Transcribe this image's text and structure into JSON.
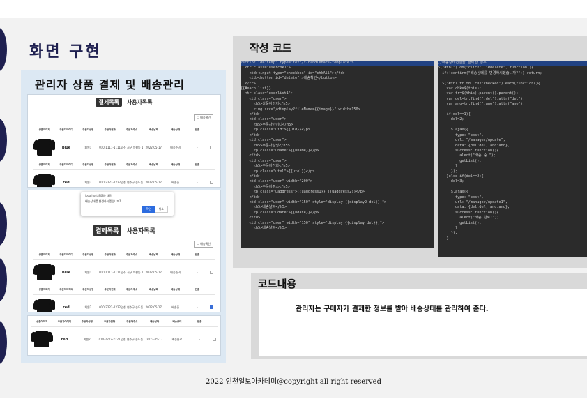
{
  "page_title": "화면 구현",
  "left": {
    "title": "관리자 상품 결제 및 배송관리",
    "tab_active": "결제목록",
    "tab_inactive": "사용자목록",
    "delete_button": "배송확인",
    "headers": [
      "상품이미지",
      "주문자아이디",
      "주문자성명",
      "주문자전화",
      "주문자주소",
      "배송날짜",
      "배송상태",
      "반품"
    ],
    "rows_a": [
      {
        "name": "blue",
        "info": [
          "회원1",
          "010-1111-1111",
          "광주 서구 치평동 1 세부주소",
          "2022-05-17",
          "배송준비"
        ]
      },
      {
        "name": "red",
        "info": [
          "회원2",
          "010-2222-2222",
          "인천 연수구 송도동 2 세부주소",
          "2022-05-17",
          "배송중"
        ]
      }
    ],
    "dialog_host": "localhost:8080 내용:",
    "dialog_msg": "배송상태를 변경하시겠습니까?",
    "dialog_ok": "확인",
    "dialog_cancel": "취소",
    "rows_b": [
      {
        "name": "blue",
        "info": [
          "회원1",
          "010-1111-1111",
          "광주 서구 치평동 1 세부주소",
          "2022-05-17",
          "배송준비"
        ]
      },
      {
        "name": "red",
        "info": [
          "회원2",
          "010-2222-2222",
          "인천 연수구 송도동 2 세부주소",
          "2022-05-17",
          "배송중"
        ]
      }
    ],
    "rows_c": [
      {
        "name": "red",
        "info": [
          "회원2",
          "010-2222-2222",
          "인천 연수구 송도동 2 세부주소",
          "2022-05-17",
          "배송완료"
        ]
      }
    ]
  },
  "code_section": {
    "title": "작성 코드",
    "template_code": [
      "<script id=\"temp\" type=\"text/x-handlebars-template\">",
      "  <tr class=\"userchk1\">",
      "    <td><input type=\"checkbox\" id=\"chkAll\"></td>",
      "    <td><button id=\"delete\" >배송확인</button>",
      "  </tr>",
      "{{#each list}}",
      "  <tr class=\"userlist1\">",
      "    <td class=\"user\">",
      "      <h5>상품이미지</h5>",
      "      <img src=\"/display?fileName={{image}}\" width=150>",
      "    </td>",
      "    <td class=\"user\">",
      "      <h5>주문자아이디</h5>",
      "      <p class=\"uid\">{{uid}}</p>",
      "    </td>",
      "    <td class=\"user\">",
      "      <h5>주문자성명</h5>",
      "      <p class=\"uname\">{{uname}}</p>",
      "    </td>",
      "    <td class=\"user\">",
      "      <h5>주문자전화</h5>",
      "      <p class=\"utel\">{{utel}}</p>",
      "    </td>",
      "    <td class=\"user\" width=\"200\">",
      "      <h5>주문자주소</h5>",
      "      <p class=\"uaddress\">{{uaddress1}} {{uaddress2}}</p>",
      "    </td>",
      "    <td class=\"user\" width=\"150\" style=\"display:{{display2 del}};\">",
      "      <h5>배송날짜</h5>",
      "      <p class=\"udate\">{{udate}}</p>",
      "    </td>",
      "    <td class=\"user\" width=\"150\" style=\"display:{{display del}};\">",
      "      <h5>배송날짜</h5>"
    ],
    "js_code": [
      "//배송상태변경을 클릭한 경우",
      "$(\"#tbl\").on(\"click\", \"#delete\", function(){",
      "  if(!confirm(\"배송상태를 변경하시겠습니까?\")) return;",
      "",
      "  $(\"#tbl tr td .chk:checked\").each(function(){",
      "    var chk=$(this);",
      "    var tr=$(this).parent().parent();",
      "    var del=tr.find(\".del\").attr(\"del\");",
      "    var ano=tr.find(\".ano\").attr(\"ano\");",
      "",
      "    if(del==1){",
      "      del=2;",
      "",
      "      $.ajax({",
      "        type: \"post\",",
      "        url: \"/manager/update\",",
      "        data: {del:del, ano:ano},",
      "        success: function(){",
      "          alert(\"배송 중 \");",
      "          getList();",
      "        }",
      "      });",
      "    }else if(del==2){",
      "      del=3;",
      "",
      "      $.ajax({",
      "        type: \"post\",",
      "        url: \"/manager/update1\",",
      "        data: {del:del, ano:ano},",
      "        success: function(){",
      "          alert(\"배송 완료!\");",
      "          getList();",
      "        }",
      "      });",
      "    }"
    ]
  },
  "explain": {
    "title": "코드내용",
    "text": "관리자는 구매자가 결제한 정보를 받아 배송상태를 관리하여 준다."
  },
  "footer": "2022 인천일보아카데미@copyright all right reserved",
  "colors": {
    "navy": "#1f2050",
    "panel_blue": "#dce8f3",
    "code_bg": "#2b2b2b",
    "accent_blue": "#2d6cdf"
  }
}
